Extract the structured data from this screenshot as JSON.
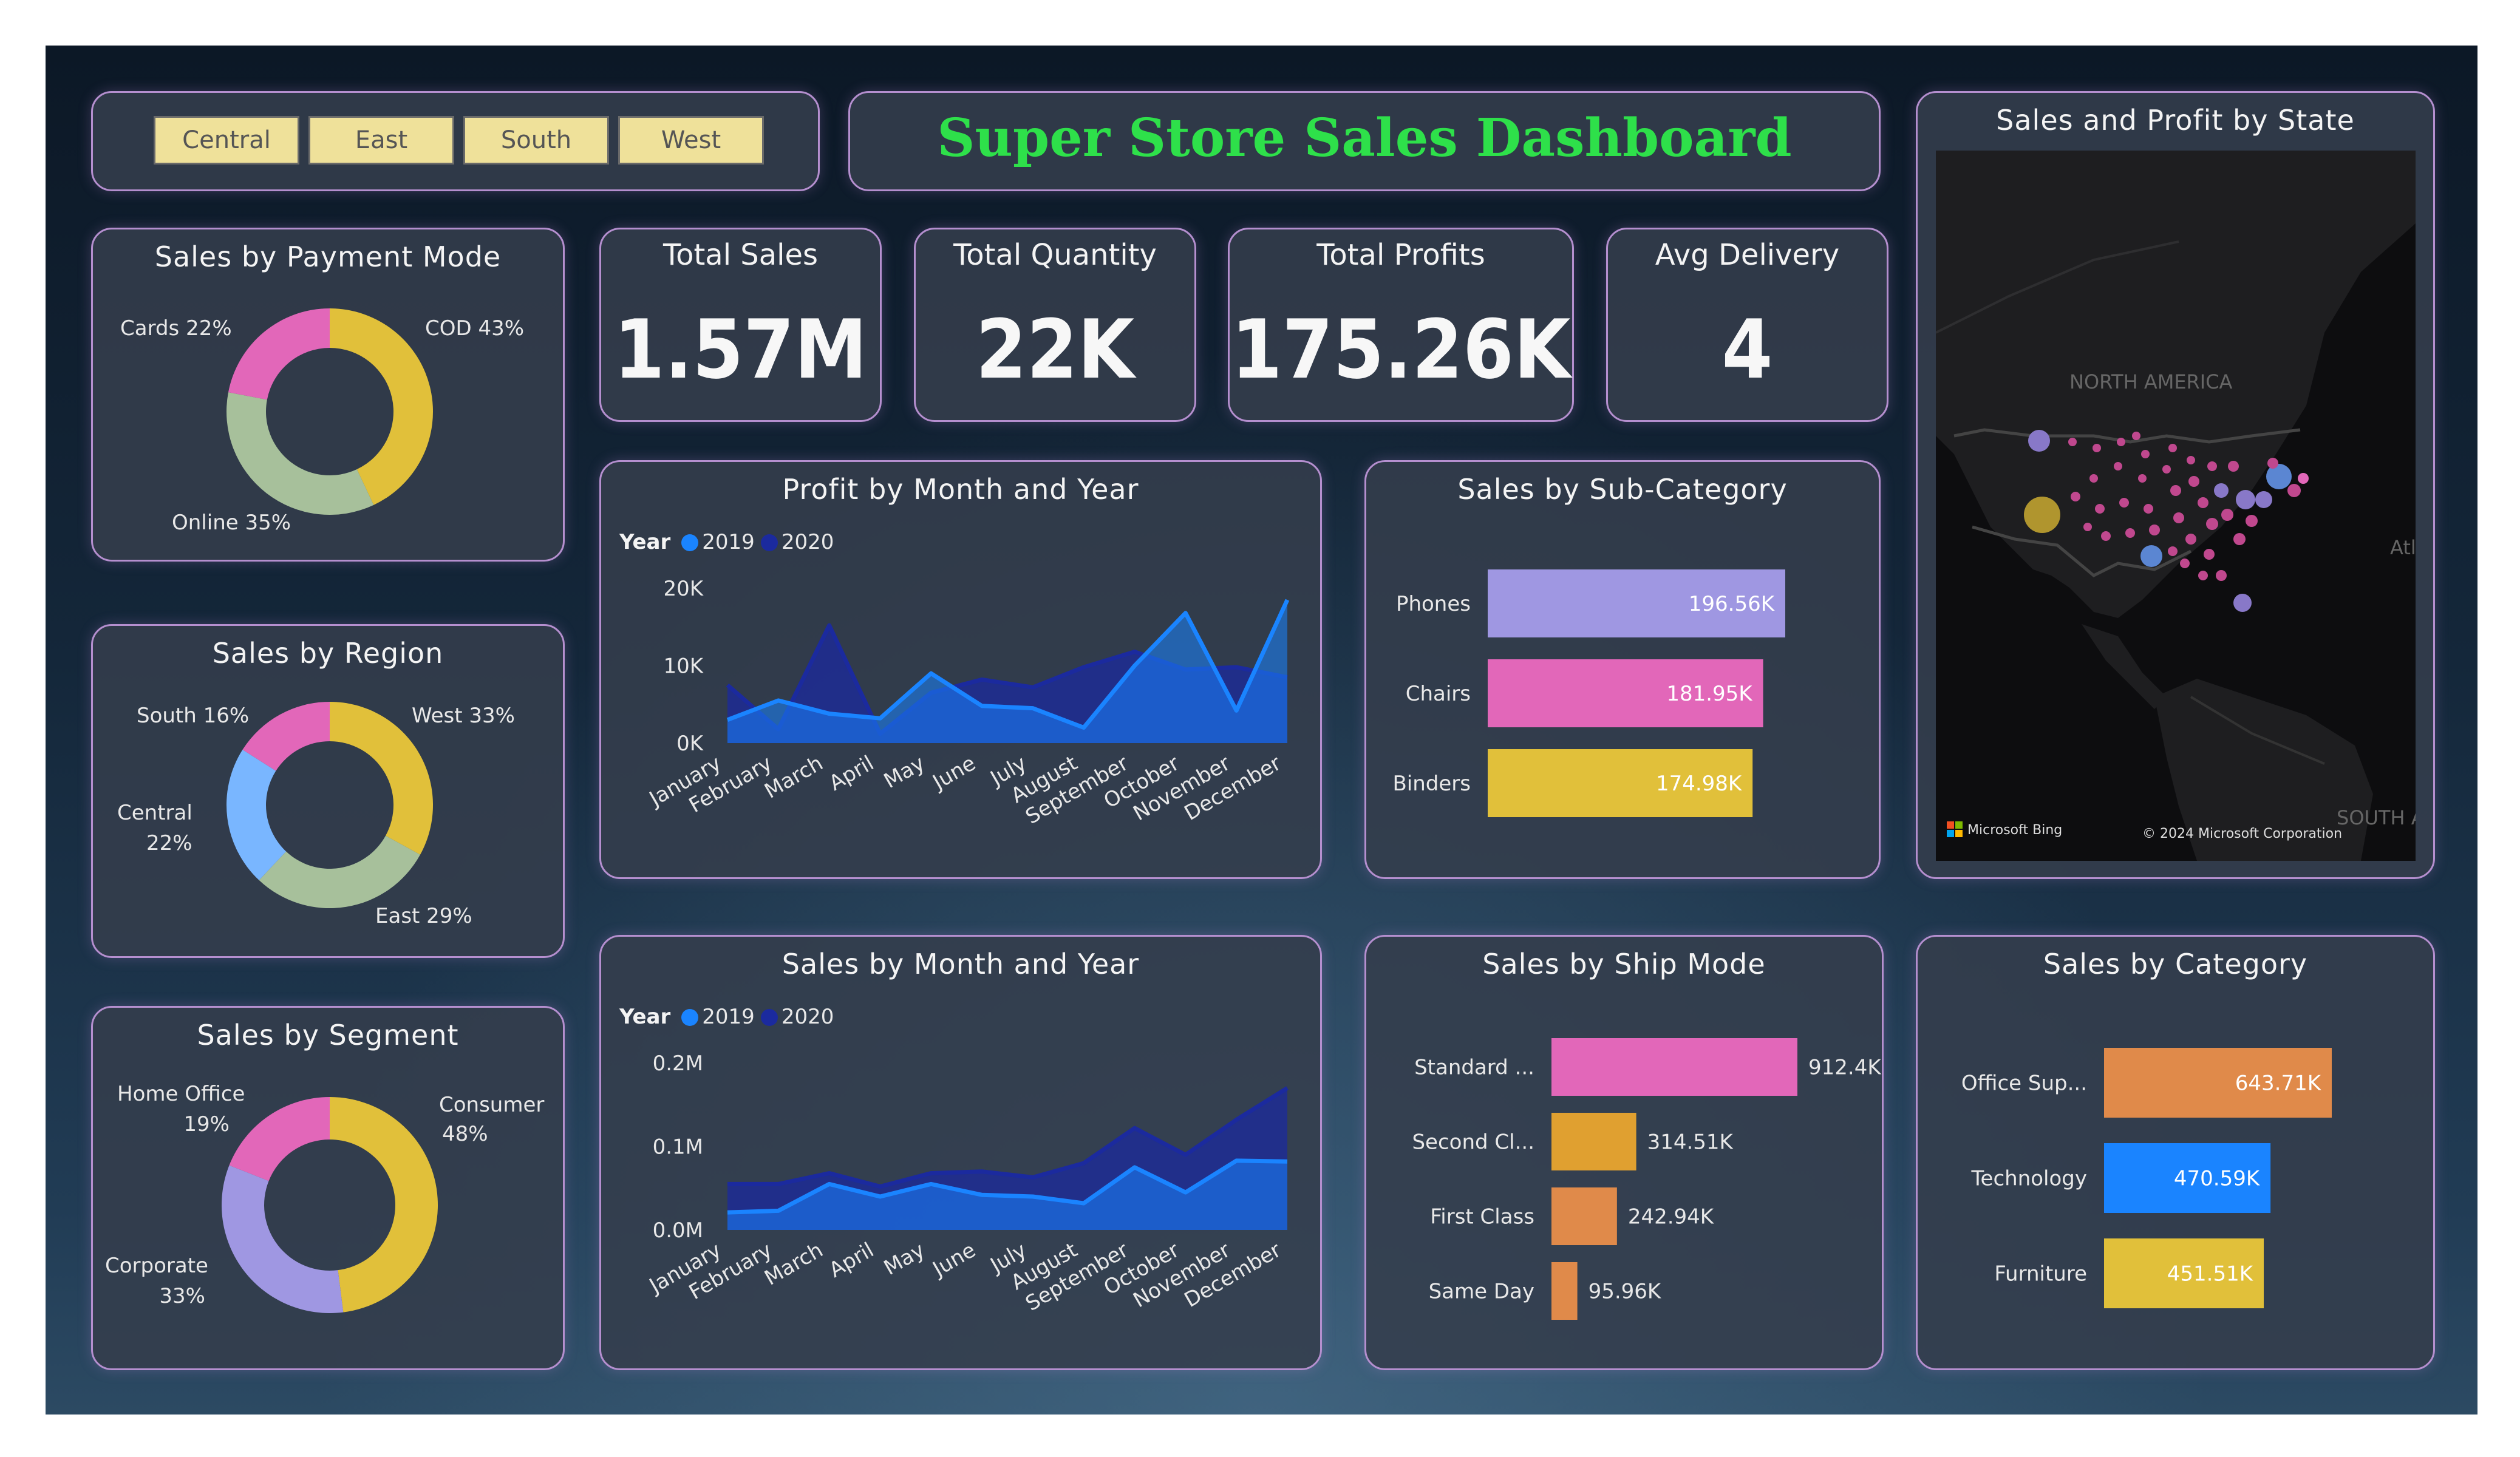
{
  "slicer": {
    "buttons": [
      "Central",
      "East",
      "South",
      "West"
    ]
  },
  "header": {
    "title": "Super Store Sales Dashboard"
  },
  "kpis": [
    {
      "label": "Total Sales",
      "value": "1.57M"
    },
    {
      "label": "Total Quantity",
      "value": "22K"
    },
    {
      "label": "Total Profits",
      "value": "175.26K"
    },
    {
      "label": "Avg Delivery",
      "value": "4"
    }
  ],
  "colors": {
    "yellow": "#e1c03a",
    "pink": "#e267b9",
    "sage": "#a7c09b",
    "lightblue": "#79b6ff",
    "lavender": "#9f97e2",
    "s2019": "#1a84ff",
    "s2020": "#1b2a9e",
    "orange": "#e08a4a",
    "amber": "#e0a030"
  },
  "payment_mode": {
    "title": "Sales by Payment Mode",
    "labels": {
      "cod": "COD 43%",
      "cards": "Cards 22%",
      "online": "Online 35%"
    }
  },
  "region": {
    "title": "Sales by Region",
    "labels": {
      "west": "West 33%",
      "south": "South 16%",
      "central_a": "Central",
      "central_b": "22%",
      "east": "East 29%"
    }
  },
  "segment": {
    "title": "Sales by Segment",
    "labels": {
      "consumer_a": "Consumer",
      "consumer_b": "48%",
      "home_a": "Home Office",
      "home_b": "19%",
      "corp_a": "Corporate",
      "corp_b": "33%"
    }
  },
  "profit_chart": {
    "title": "Profit by Month and Year",
    "legend": {
      "title": "Year",
      "s1": "2019",
      "s2": "2020"
    },
    "yticks": [
      "20K",
      "10K",
      "0K"
    ]
  },
  "sales_chart": {
    "title": "Sales by Month and Year",
    "legend": {
      "title": "Year",
      "s1": "2019",
      "s2": "2020"
    },
    "yticks": [
      "0.2M",
      "0.1M",
      "0.0M"
    ]
  },
  "subcat": {
    "title": "Sales by Sub-Category"
  },
  "shipmode": {
    "title": "Sales by Ship Mode"
  },
  "category": {
    "title": "Sales by Category"
  },
  "map": {
    "title": "Sales and Profit by State",
    "region_label": "NORTH AMERICA",
    "south_label": "SOUTH A",
    "atl_label": "Atl",
    "bing": "Microsoft Bing",
    "copyright": "© 2024 Microsoft Corporation"
  },
  "chart_data": [
    {
      "type": "pie",
      "title": "Sales by Payment Mode",
      "categories": [
        "COD",
        "Online",
        "Cards"
      ],
      "values": [
        43,
        35,
        22
      ]
    },
    {
      "type": "pie",
      "title": "Sales by Region",
      "categories": [
        "West",
        "East",
        "Central",
        "South"
      ],
      "values": [
        33,
        29,
        22,
        16
      ]
    },
    {
      "type": "pie",
      "title": "Sales by Segment",
      "categories": [
        "Consumer",
        "Corporate",
        "Home Office"
      ],
      "values": [
        48,
        33,
        19
      ]
    },
    {
      "type": "area",
      "title": "Profit by Month and Year",
      "categories": [
        "January",
        "February",
        "March",
        "April",
        "May",
        "June",
        "July",
        "August",
        "September",
        "October",
        "November",
        "December"
      ],
      "ylim": [
        0,
        20000
      ],
      "series": [
        {
          "name": "2019",
          "values": [
            3000,
            5500,
            3800,
            3200,
            9000,
            4800,
            4500,
            2000,
            10000,
            16800,
            4200,
            18500
          ]
        },
        {
          "name": "2020",
          "values": [
            7500,
            1800,
            15200,
            1200,
            6500,
            8200,
            7200,
            9800,
            11800,
            9500,
            9800,
            8500
          ]
        }
      ]
    },
    {
      "type": "area",
      "title": "Sales by Month and Year",
      "categories": [
        "January",
        "February",
        "March",
        "April",
        "May",
        "June",
        "July",
        "August",
        "September",
        "October",
        "November",
        "December"
      ],
      "ylim": [
        0,
        0.2
      ],
      "series": [
        {
          "name": "2019",
          "values": [
            0.021,
            0.023,
            0.055,
            0.04,
            0.055,
            0.042,
            0.04,
            0.032,
            0.075,
            0.045,
            0.083,
            0.082
          ]
        },
        {
          "name": "2020",
          "values": [
            0.055,
            0.055,
            0.068,
            0.052,
            0.068,
            0.07,
            0.063,
            0.08,
            0.122,
            0.09,
            0.132,
            0.17
          ]
        }
      ]
    },
    {
      "type": "bar",
      "title": "Sales by Sub-Category",
      "categories": [
        "Phones",
        "Chairs",
        "Binders"
      ],
      "values": [
        196.56,
        181.95,
        174.98
      ],
      "labels": [
        "196.56K",
        "181.95K",
        "174.98K"
      ]
    },
    {
      "type": "bar",
      "title": "Sales by Ship Mode",
      "categories": [
        "Standard ...",
        "Second Cl...",
        "First Class",
        "Same Day"
      ],
      "values": [
        912.4,
        314.51,
        242.94,
        95.96
      ],
      "labels": [
        "912.4K",
        "314.51K",
        "242.94K",
        "95.96K"
      ]
    },
    {
      "type": "bar",
      "title": "Sales by Category",
      "categories": [
        "Office Sup...",
        "Technology",
        "Furniture"
      ],
      "values": [
        643.71,
        470.59,
        451.51
      ],
      "labels": [
        "643.71K",
        "470.59K",
        "451.51K"
      ]
    }
  ]
}
